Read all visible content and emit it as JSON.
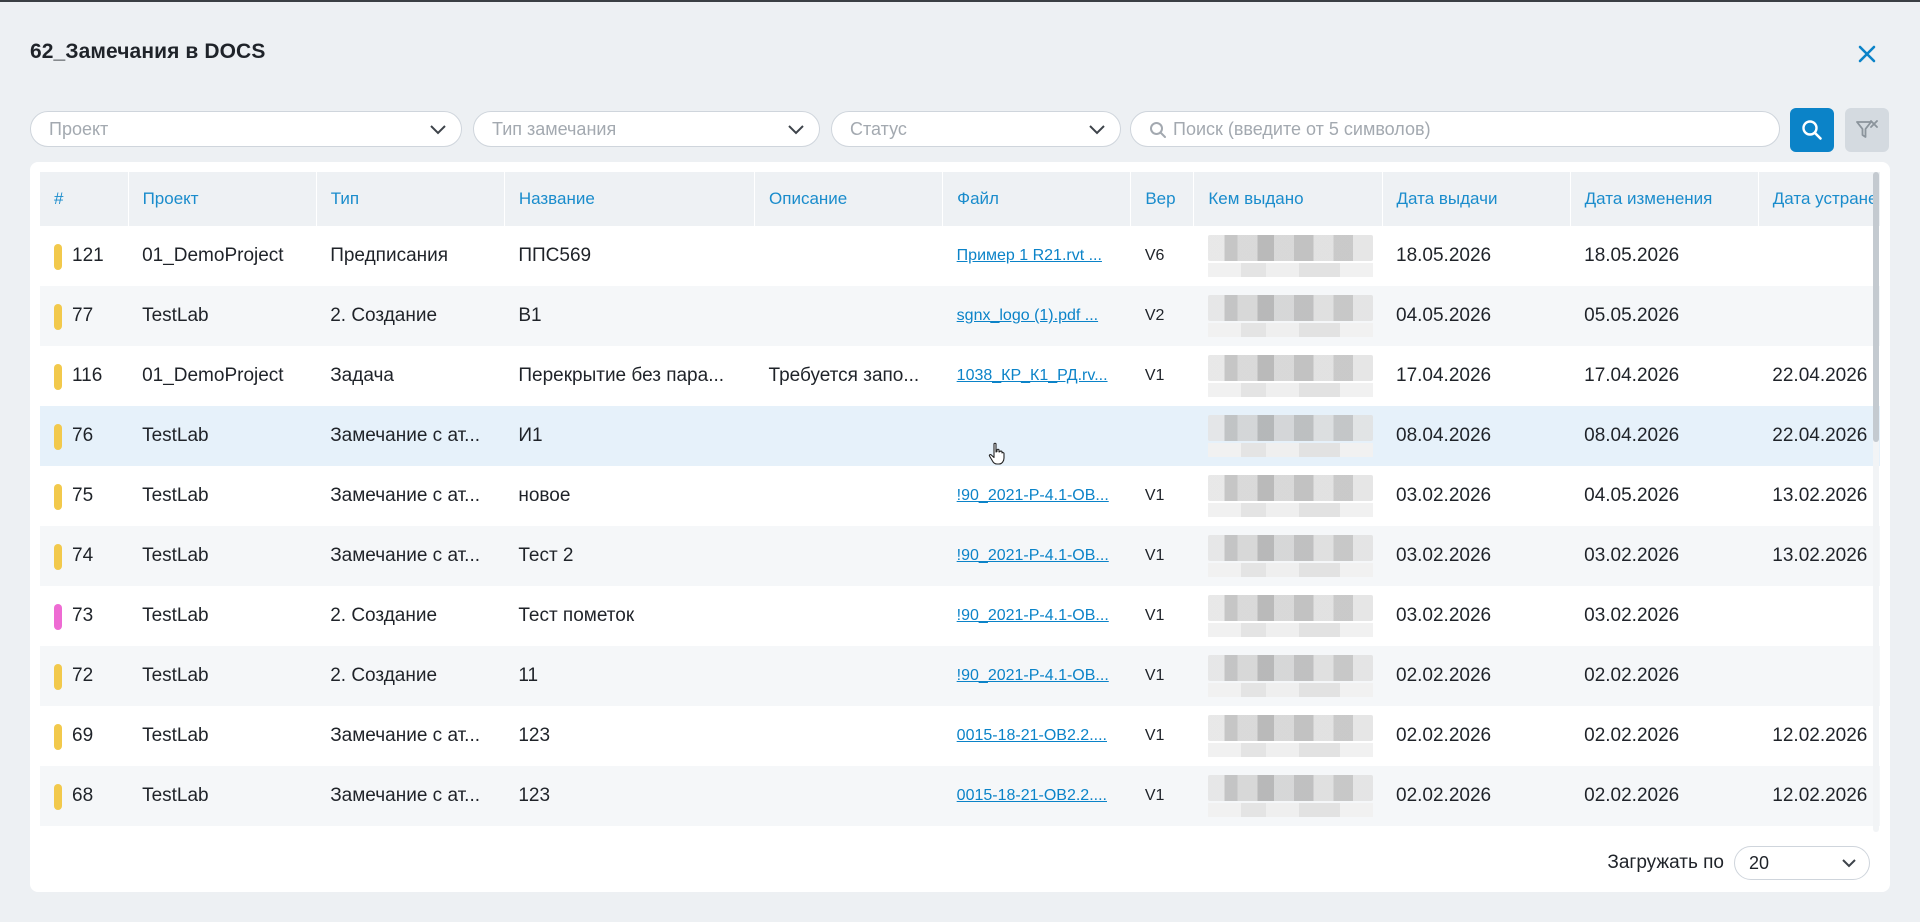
{
  "title": "62_Замечания в DOCS",
  "filters": {
    "project_placeholder": "Проект",
    "type_placeholder": "Тип замечания",
    "status_placeholder": "Статус",
    "search_placeholder": "Поиск (введите от 5 символов)"
  },
  "table": {
    "columns": [
      "#",
      "Проект",
      "Тип",
      "Название",
      "Описание",
      "Файл",
      "Вер",
      "Кем выдано",
      "Дата выдачи",
      "Дата изменения",
      "Дата устране"
    ],
    "rows": [
      {
        "num": "121",
        "color": "#f2c94c",
        "project": "01_DemoProject",
        "type": "Предписания",
        "name": "ППС569",
        "desc": "",
        "file": "Пример 1 R21.rvt ...",
        "ver": "V6",
        "issued": "18.05.2026",
        "changed": "18.05.2026",
        "fixed": ""
      },
      {
        "num": "77",
        "color": "#f2c94c",
        "project": "TestLab",
        "type": "2. Создание",
        "name": "В1",
        "desc": "",
        "file": "sgnx_logo (1).pdf ...",
        "ver": "V2",
        "issued": "04.05.2026",
        "changed": "05.05.2026",
        "fixed": ""
      },
      {
        "num": "116",
        "color": "#f2c94c",
        "project": "01_DemoProject",
        "type": "Задача",
        "name": "Перекрытие без пара...",
        "desc": "Требуется запо...",
        "file": "1038_КР_К1_РД.rv...",
        "ver": "V1",
        "issued": "17.04.2026",
        "changed": "17.04.2026",
        "fixed": "22.04.2026"
      },
      {
        "num": "76",
        "color": "#f2c94c",
        "project": "TestLab",
        "type": "Замечание с ат...",
        "name": "И1",
        "desc": "",
        "file": "",
        "ver": "",
        "issued": "08.04.2026",
        "changed": "08.04.2026",
        "fixed": "22.04.2026"
      },
      {
        "num": "75",
        "color": "#f2c94c",
        "project": "TestLab",
        "type": "Замечание с ат...",
        "name": "новое",
        "desc": "",
        "file": "!90_2021-Р-4.1-ОВ...",
        "ver": "V1",
        "issued": "03.02.2026",
        "changed": "04.05.2026",
        "fixed": "13.02.2026"
      },
      {
        "num": "74",
        "color": "#f2c94c",
        "project": "TestLab",
        "type": "Замечание с ат...",
        "name": "Тест 2",
        "desc": "",
        "file": "!90_2021-Р-4.1-ОВ...",
        "ver": "V1",
        "issued": "03.02.2026",
        "changed": "03.02.2026",
        "fixed": "13.02.2026"
      },
      {
        "num": "73",
        "color": "#ee6bd3",
        "project": "TestLab",
        "type": "2. Создание",
        "name": "Тест пометок",
        "desc": "",
        "file": "!90_2021-Р-4.1-ОВ...",
        "ver": "V1",
        "issued": "03.02.2026",
        "changed": "03.02.2026",
        "fixed": ""
      },
      {
        "num": "72",
        "color": "#f2c94c",
        "project": "TestLab",
        "type": "2. Создание",
        "name": "11",
        "desc": "",
        "file": "!90_2021-Р-4.1-ОВ...",
        "ver": "V1",
        "issued": "02.02.2026",
        "changed": "02.02.2026",
        "fixed": ""
      },
      {
        "num": "69",
        "color": "#f2c94c",
        "project": "TestLab",
        "type": "Замечание с ат...",
        "name": "123",
        "desc": "",
        "file": "0015-18-21-ОВ2.2....",
        "ver": "V1",
        "issued": "02.02.2026",
        "changed": "02.02.2026",
        "fixed": "12.02.2026"
      },
      {
        "num": "68",
        "color": "#f2c94c",
        "project": "TestLab",
        "type": "Замечание с ат...",
        "name": "123",
        "desc": "",
        "file": "0015-18-21-ОВ2.2....",
        "ver": "V1",
        "issued": "02.02.2026",
        "changed": "02.02.2026",
        "fixed": "12.02.2026"
      }
    ]
  },
  "pager": {
    "label": "Загружать по",
    "value": "20"
  },
  "colors": {
    "accent": "#0b83c8",
    "header_text": "#1a8ccc",
    "marker_yellow": "#f2c94c",
    "marker_pink": "#ee6bd3"
  },
  "icons": {
    "close": "close-icon",
    "search": "search-icon",
    "filter_clear": "filter-clear-icon",
    "chevron": "chevron-down-icon"
  }
}
